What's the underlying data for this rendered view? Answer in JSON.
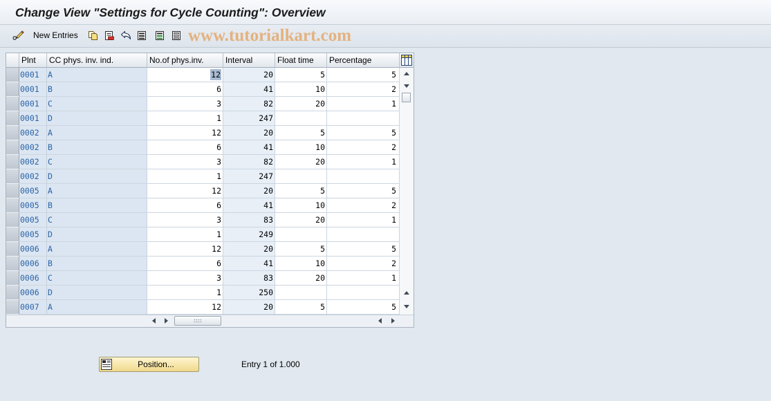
{
  "window": {
    "title": "Change View \"Settings for Cycle Counting\": Overview"
  },
  "toolbar": {
    "new_entries_label": "New Entries",
    "icons": [
      "display-change-icon",
      "copy-as-icon",
      "delete-icon",
      "undo-change-icon",
      "select-all-icon",
      "select-block-icon",
      "deselect-all-icon"
    ],
    "watermark": "www.tutorialkart.com"
  },
  "table": {
    "columns": [
      "Plnt",
      "CC phys. inv. ind.",
      "No.of phys.inv.",
      "Interval",
      "Float time",
      "Percentage"
    ],
    "settings_icon": "table-settings-icon",
    "cursor": {
      "row": 0,
      "col": 2
    },
    "rows": [
      [
        "0001",
        "A",
        "12",
        "20",
        "5",
        "5"
      ],
      [
        "0001",
        "B",
        "6",
        "41",
        "10",
        "2"
      ],
      [
        "0001",
        "C",
        "3",
        "82",
        "20",
        "1"
      ],
      [
        "0001",
        "D",
        "1",
        "247",
        "",
        ""
      ],
      [
        "0002",
        "A",
        "12",
        "20",
        "5",
        "5"
      ],
      [
        "0002",
        "B",
        "6",
        "41",
        "10",
        "2"
      ],
      [
        "0002",
        "C",
        "3",
        "82",
        "20",
        "1"
      ],
      [
        "0002",
        "D",
        "1",
        "247",
        "",
        ""
      ],
      [
        "0005",
        "A",
        "12",
        "20",
        "5",
        "5"
      ],
      [
        "0005",
        "B",
        "6",
        "41",
        "10",
        "2"
      ],
      [
        "0005",
        "C",
        "3",
        "83",
        "20",
        "1"
      ],
      [
        "0005",
        "D",
        "1",
        "249",
        "",
        ""
      ],
      [
        "0006",
        "A",
        "12",
        "20",
        "5",
        "5"
      ],
      [
        "0006",
        "B",
        "6",
        "41",
        "10",
        "2"
      ],
      [
        "0006",
        "C",
        "3",
        "83",
        "20",
        "1"
      ],
      [
        "0006",
        "D",
        "1",
        "250",
        "",
        ""
      ],
      [
        "0007",
        "A",
        "12",
        "20",
        "5",
        "5"
      ]
    ],
    "scrollbar_icons": [
      "arrow-up-icon",
      "arrow-down-icon",
      "arrow-left-icon",
      "arrow-right-icon"
    ]
  },
  "footer": {
    "position_label": "Position...",
    "position_icon": "position-icon",
    "entry_info": "Entry 1 of 1.000"
  },
  "colors": {
    "key_field_text": "#2a62a6",
    "key_field_bg": "#dbe6f2",
    "button_bg": "#f3dc94",
    "watermark": "#e4a96c"
  }
}
